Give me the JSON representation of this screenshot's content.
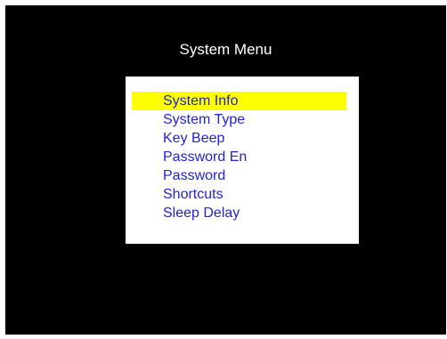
{
  "title": "System Menu",
  "menu": {
    "items": [
      {
        "label": "System Info"
      },
      {
        "label": "System Type"
      },
      {
        "label": "Key Beep"
      },
      {
        "label": "Password En"
      },
      {
        "label": "Password"
      },
      {
        "label": "Shortcuts"
      },
      {
        "label": "Sleep Delay"
      }
    ],
    "selected_index": 0
  },
  "colors": {
    "screen_background": "#000000",
    "panel_background": "#ffffff",
    "item_text": "#2323d6",
    "selection_highlight": "#ffff00",
    "title_text": "#ffffff"
  }
}
